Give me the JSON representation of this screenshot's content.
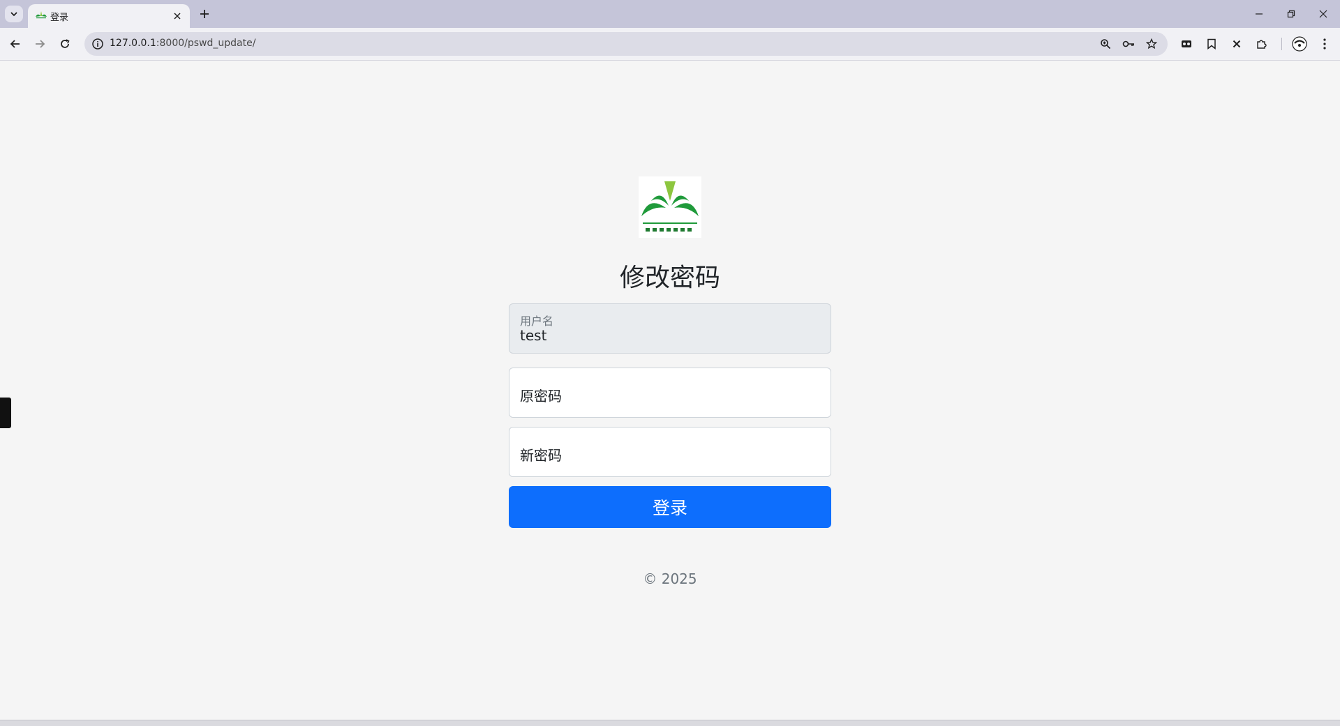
{
  "browser": {
    "tab": {
      "title": "登录",
      "favicon": "leaf-logo-icon"
    },
    "address": {
      "host": "127.0.0.1",
      "path": ":8000/pswd_update/"
    }
  },
  "page": {
    "title": "修改密码",
    "username": {
      "label": "用户名",
      "value": "test"
    },
    "old_password": {
      "placeholder": "原密码"
    },
    "new_password": {
      "placeholder": "新密码"
    },
    "submit_label": "登录",
    "copyright": "© 2025"
  },
  "colors": {
    "primary": "#0d6efd",
    "logo_green": "#1f9a3a",
    "logo_light_green": "#8dc63f"
  }
}
